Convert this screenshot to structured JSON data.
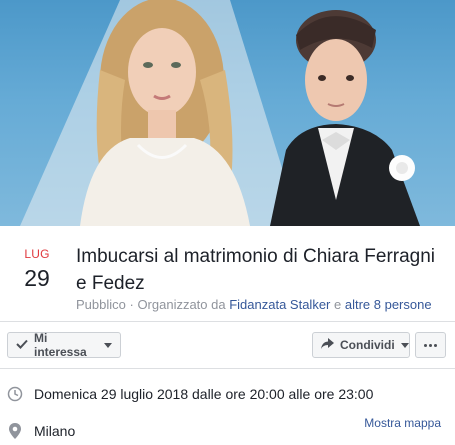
{
  "event": {
    "cover_alt": "cover-photo",
    "date": {
      "month": "LUG",
      "day": "29"
    },
    "title": "Imbucarsi al matrimonio di Chiara Ferragni e Fedez",
    "meta": {
      "privacy": "Pubblico",
      "separator": " · ",
      "organized_by": "Organizzato da ",
      "organizer": "Fidanzata Stalker",
      "conjunction": " e ",
      "others": "altre 8 persone"
    }
  },
  "actions": {
    "interested_label": "Mi interessa",
    "share_label": "Condividi",
    "more_label": "…"
  },
  "details": {
    "time": "Domenica 29 luglio 2018 dalle ore 20:00 alle ore 23:00",
    "place": "Milano",
    "map_link": "Mostra mappa"
  },
  "colors": {
    "month": "#e0393e",
    "link": "#365899",
    "meta": "#90949c",
    "cover_sky": "#66abd6"
  },
  "icons": {
    "interested": "star-check-icon",
    "share": "share-arrow-icon",
    "more": "more-dots-icon",
    "time": "clock-icon",
    "place": "location-pin-icon"
  }
}
